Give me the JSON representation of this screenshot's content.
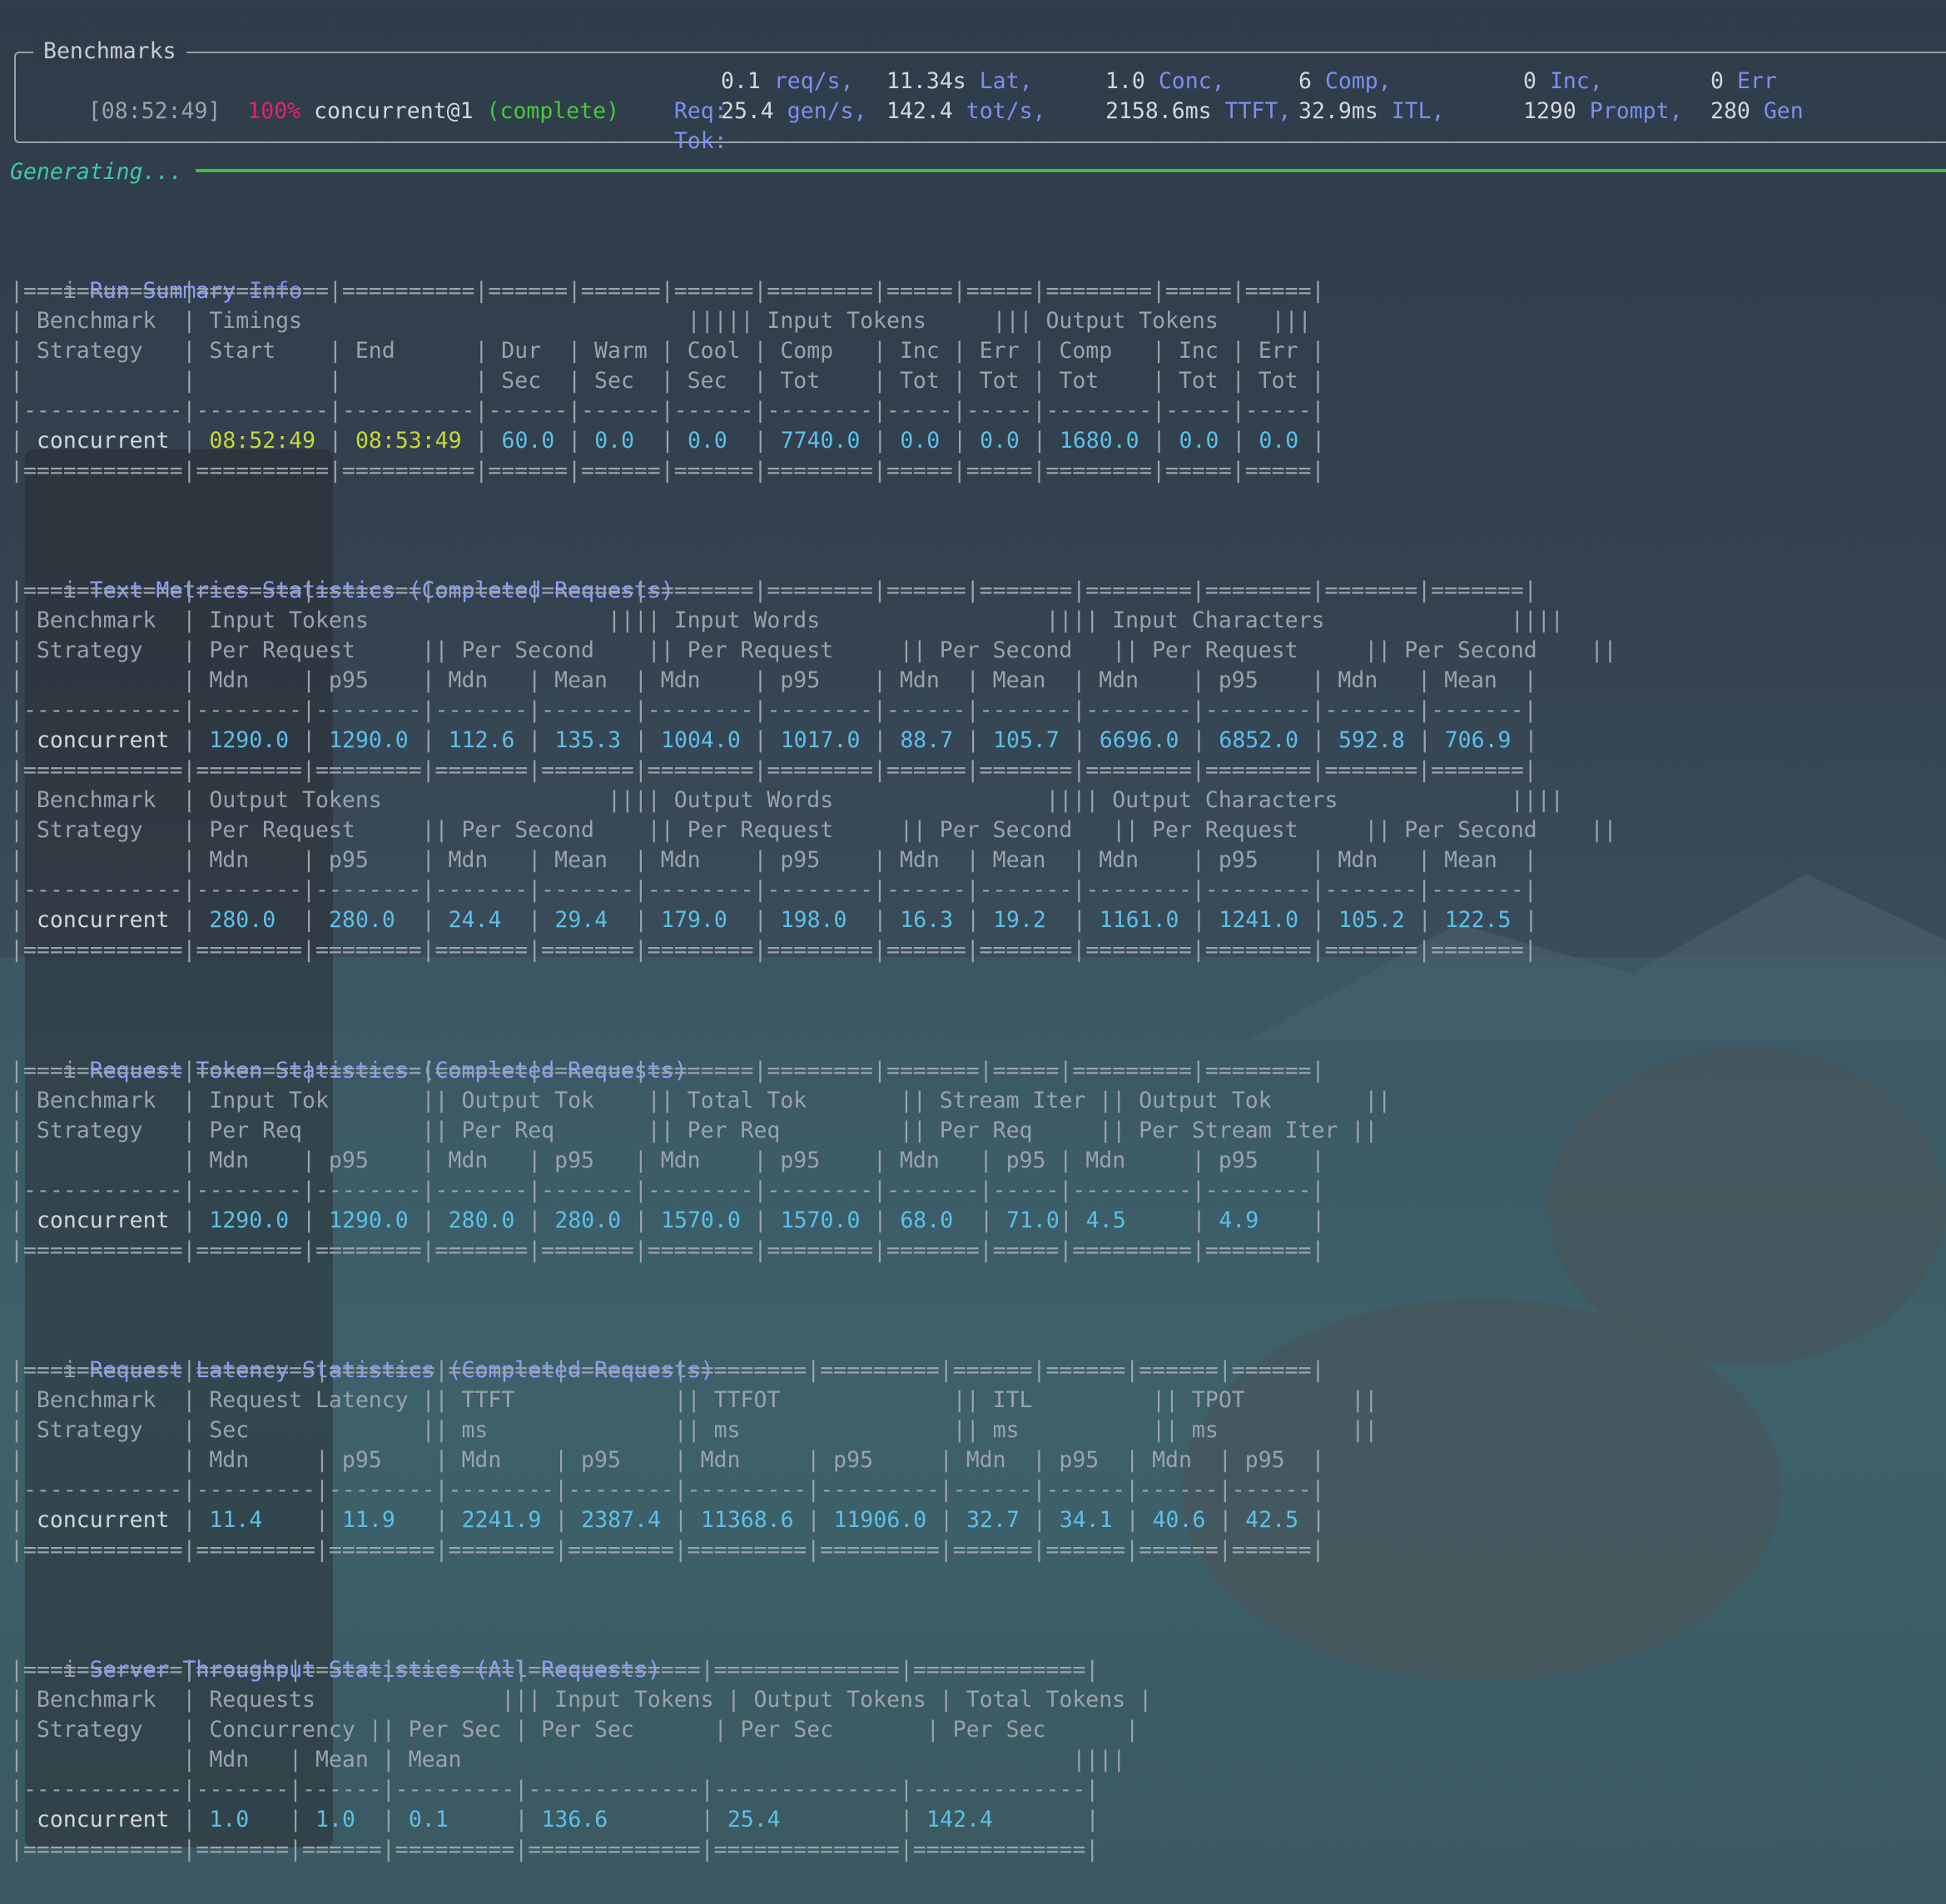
{
  "panel": {
    "title": "Benchmarks",
    "time": "[08:52:49]",
    "pct": "100%",
    "name": "concurrent@1",
    "status_open": "(",
    "status": "complete",
    "status_close": ")",
    "req_label": "Req:",
    "tok_label": "Tok:",
    "req": [
      {
        "value": "0.1",
        "unit": "req/s,"
      },
      {
        "value": "11.34s",
        "unit": "Lat,"
      },
      {
        "value": "1.0",
        "unit": "Conc,"
      },
      {
        "value": "6",
        "unit": "Comp,"
      },
      {
        "value": "0",
        "unit": "Inc,"
      },
      {
        "value": "0",
        "unit": "Err"
      }
    ],
    "tok": [
      {
        "value": "25.4",
        "unit": "gen/s,"
      },
      {
        "value": "142.4",
        "unit": "tot/s,"
      },
      {
        "value": "2158.6ms",
        "unit": "TTFT,"
      },
      {
        "value": "32.9ms",
        "unit": "ITL,"
      },
      {
        "value": "1290",
        "unit": "Prompt,"
      },
      {
        "value": "280",
        "unit": "Gen"
      }
    ]
  },
  "generating": "Generating...",
  "sections": {
    "run": {
      "icon": "i",
      "title": "Run Summary",
      "badge": "Info",
      "lines": [
        "|============|==========|==========|======|======|======|========|=====|=====|========|=====|=====|",
        "| Benchmark  | Timings                             ||||| Input Tokens     ||| Output Tokens    |||",
        "| Strategy   | Start    | End      | Dur  | Warm | Cool | Comp   | Inc | Err | Comp   | Inc | Err |",
        "|            |          |          | Sec  | Sec  | Sec  | Tot    | Tot | Tot | Tot    | Tot | Tot |",
        "|------------|----------|----------|------|------|------|--------|-----|-----|--------|-----|-----|"
      ],
      "row": {
        "strategy": "concurrent",
        "start": "08:52:49",
        "end": "08:53:49",
        "cells": [
          "60.0",
          "0.0",
          "0.0",
          "7740.0",
          "0.0",
          "0.0",
          "1680.0",
          "0.0",
          "0.0"
        ]
      },
      "footer": "|============|==========|==========|======|======|======|========|=====|=====|========|=====|=====|"
    },
    "text": {
      "icon": "i",
      "title": "Text Metrics Statistics (Completed Requests)",
      "lines1": [
        "|============|========|========|=======|=======|========|========|======|=======|========|========|=======|=======|",
        "| Benchmark  | Input Tokens                  |||| Input Words                 |||| Input Characters              ||||",
        "| Strategy   | Per Request     || Per Second    || Per Request     || Per Second   || Per Request     || Per Second    ||",
        "|            | Mdn    | p95    | Mdn   | Mean  | Mdn    | p95    | Mdn  | Mean  | Mdn    | p95    | Mdn   | Mean  |",
        "|------------|--------|--------|-------|-------|--------|--------|------|-------|--------|--------|-------|-------|"
      ],
      "row1": [
        "1290.0",
        "1290.0",
        "112.6",
        "135.3",
        "1004.0",
        "1017.0",
        "88.7",
        "105.7",
        "6696.0",
        "6852.0",
        "592.8",
        "706.9"
      ],
      "lines2": [
        "|============|========|========|=======|=======|========|========|======|=======|========|========|=======|=======|",
        "| Benchmark  | Output Tokens                 |||| Output Words                |||| Output Characters             ||||",
        "| Strategy   | Per Request     || Per Second    || Per Request     || Per Second   || Per Request     || Per Second    ||",
        "|            | Mdn    | p95    | Mdn   | Mean  | Mdn    | p95    | Mdn  | Mean  | Mdn    | p95    | Mdn   | Mean  |",
        "|------------|--------|--------|-------|-------|--------|--------|------|-------|--------|--------|-------|-------|"
      ],
      "row2": [
        "280.0",
        "280.0",
        "24.4",
        "29.4",
        "179.0",
        "198.0",
        "16.3",
        "19.2",
        "1161.0",
        "1241.0",
        "105.2",
        "122.5"
      ],
      "footer": "|============|========|========|=======|=======|========|========|======|=======|========|========|=======|=======|"
    },
    "token": {
      "icon": "i",
      "title": "Request Token Statistics (Completed Requests)",
      "lines": [
        "|============|========|========|=======|=======|========|========|=======|=====|=========|========|",
        "| Benchmark  | Input Tok       || Output Tok    || Total Tok       || Stream Iter || Output Tok       ||",
        "| Strategy   | Per Req         || Per Req       || Per Req         || Per Req     || Per Stream Iter ||",
        "|            | Mdn    | p95    | Mdn   | p95   | Mdn    | p95    | Mdn   | p95 | Mdn     | p95    |",
        "|------------|--------|--------|-------|-------|--------|--------|-------|-----|---------|--------|"
      ],
      "row": [
        "1290.0",
        "1290.0",
        "280.0",
        "280.0",
        "1570.0",
        "1570.0",
        "68.0",
        "71.0",
        "4.5",
        "4.9"
      ],
      "footer": "|============|========|========|=======|=======|========|========|=======|=====|=========|========|"
    },
    "latency": {
      "icon": "i",
      "title": "Request Latency Statistics (Completed Requests)",
      "lines": [
        "|============|=========|========|========|========|=========|=========|======|======|======|======|",
        "| Benchmark  | Request Latency || TTFT            || TTFOT             || ITL         || TPOT        ||",
        "| Strategy   | Sec             || ms              || ms                || ms          || ms          ||",
        "|            | Mdn     | p95    | Mdn    | p95    | Mdn     | p95     | Mdn  | p95  | Mdn  | p95  |",
        "|------------|---------|--------|--------|--------|---------|---------|------|------|------|------|"
      ],
      "row": [
        "11.4",
        "11.9",
        "2241.9",
        "2387.4",
        "11368.6",
        "11906.0",
        "32.7",
        "34.1",
        "40.6",
        "42.5"
      ],
      "footer": "|============|=========|========|========|========|=========|=========|======|======|======|======|"
    },
    "throughput": {
      "icon": "i",
      "title": "Server Throughput Statistics (All Requests)",
      "lines": [
        "|============|=======|======|=========|=============|==============|=============|",
        "| Benchmark  | Requests              ||| Input Tokens | Output Tokens | Total Tokens |",
        "| Strategy   | Concurrency || Per Sec | Per Sec      | Per Sec       | Per Sec      |",
        "|            | Mdn   | Mean | Mean                                              ||||",
        "|------------|-------|------|---------|-------------|--------------|-------------|"
      ],
      "row": [
        "1.0",
        "1.0",
        "0.1",
        "136.6",
        "25.4",
        "142.4"
      ],
      "footer": "|============|=======|======|=========|=============|==============|=============|"
    }
  }
}
